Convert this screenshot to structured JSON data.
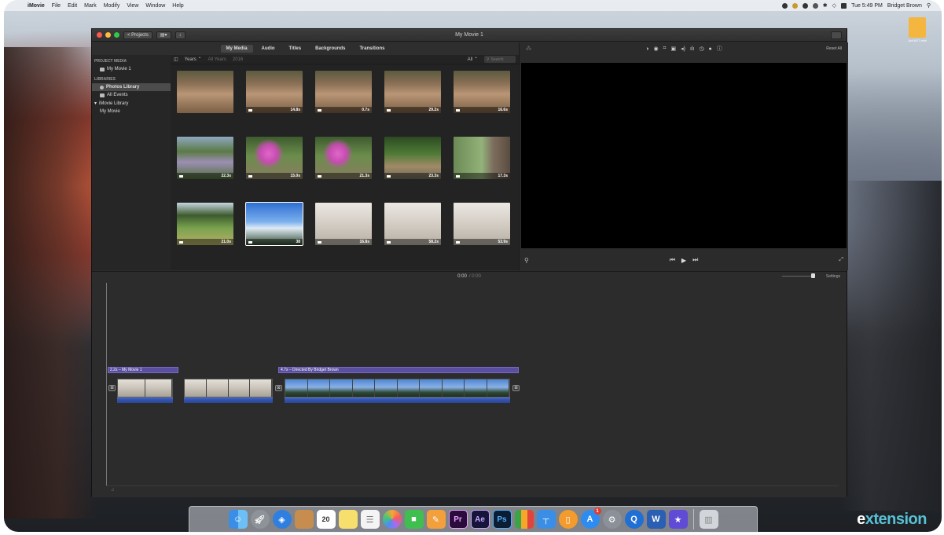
{
  "menubar": {
    "app_name": "iMovie",
    "items": [
      "File",
      "Edit",
      "Mark",
      "Modify",
      "View",
      "Window",
      "Help"
    ],
    "clock": "Tue 5:49 PM",
    "user": "Bridget Brown"
  },
  "desktop_file": {
    "label": "Jun0617-mini"
  },
  "window": {
    "title": "My Movie 1",
    "projects_label": "< Projects"
  },
  "tabs": [
    {
      "label": "My Media",
      "active": true
    },
    {
      "label": "Audio",
      "active": false
    },
    {
      "label": "Titles",
      "active": false
    },
    {
      "label": "Backgrounds",
      "active": false
    },
    {
      "label": "Transitions",
      "active": false
    }
  ],
  "sidebar": {
    "project_media_header": "PROJECT MEDIA",
    "project_item": "My Movie 1",
    "libraries_header": "LIBRARIES",
    "items": [
      {
        "label": "Photos Library",
        "selected": true
      },
      {
        "label": "All Events",
        "selected": false
      },
      {
        "label": "iMovie Library",
        "selected": false
      },
      {
        "label": "My Movie",
        "selected": false
      }
    ]
  },
  "browser": {
    "years_label": "Years",
    "all_years": "All Years",
    "year": "2016",
    "all_label": "All",
    "search_placeholder": "Search",
    "clips": [
      {
        "duration": "",
        "style": "rock"
      },
      {
        "duration": "14.8s",
        "style": "rock"
      },
      {
        "duration": "0.7s",
        "style": "rock"
      },
      {
        "duration": "29.2s",
        "style": "rock"
      },
      {
        "duration": "16.6s",
        "style": "rock"
      },
      {
        "duration": "22.3s",
        "style": "garden"
      },
      {
        "duration": "15.0s",
        "style": "flower"
      },
      {
        "duration": "21.3s",
        "style": "flower"
      },
      {
        "duration": "23.3s",
        "style": "bench"
      },
      {
        "duration": "17.3s",
        "style": "tree"
      },
      {
        "duration": "21.0s",
        "style": "lawn"
      },
      {
        "duration": "38",
        "style": "sky"
      },
      {
        "duration": "16.8s",
        "style": "sand"
      },
      {
        "duration": "58.2s",
        "style": "sand"
      },
      {
        "duration": "53.9s",
        "style": "sand"
      }
    ]
  },
  "viewer": {
    "reset_label": "Reset All"
  },
  "timeline": {
    "current_time": "0:00",
    "total_time": "/ 0:00",
    "settings_label": "Settings",
    "title_clip_1": "2.2s – My Movie 1",
    "title_clip_2": "4.7s – Directed By Bridget Brown"
  },
  "dock": {
    "icons": [
      "finder-icon",
      "launchpad-icon",
      "safari-icon",
      "contacts-icon",
      "calendar-icon",
      "notes-icon",
      "reminders-icon",
      "photos-icon",
      "facetime-icon",
      "pages-icon",
      "premiere-icon",
      "after-effects-icon",
      "photoshop-icon",
      "numbers-icon",
      "keynote-icon",
      "ibooks-icon",
      "app-store-icon",
      "system-preferences-icon",
      "quicktime-icon",
      "word-icon",
      "imovie-icon",
      "trash-icon"
    ],
    "calendar_day": "20",
    "premiere_label": "Pr",
    "ae_label": "Ae",
    "ps_label": "Ps",
    "badge": "1"
  },
  "watermark": {
    "e": "e",
    "rest": "xtension"
  }
}
